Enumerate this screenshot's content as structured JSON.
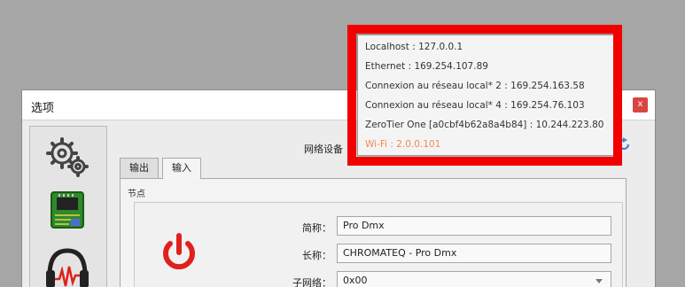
{
  "window": {
    "title": "选项",
    "close_glyph": "x"
  },
  "sidebar": {
    "items": [
      {
        "icon": "gears-icon"
      },
      {
        "icon": "circuit-board-icon"
      },
      {
        "icon": "headphones-audio-icon"
      }
    ]
  },
  "network": {
    "label": "网络设备",
    "refresh_icon": "refresh-icon",
    "options": [
      "Localhost : 127.0.0.1",
      "Ethernet : 169.254.107.89",
      "Connexion au réseau local* 2 : 169.254.163.58",
      "Connexion au réseau local* 4 : 169.254.76.103",
      "ZeroTier One [a0cbf4b62a8a4b84] : 10.244.223.80",
      "Wi-Fi : 2.0.0.101"
    ],
    "selected_index": 5
  },
  "tabs": [
    {
      "label": "输出",
      "active": false
    },
    {
      "label": "输入",
      "active": true
    }
  ],
  "node": {
    "group_label": "节点",
    "power_icon": "power-icon",
    "power_color": "#e0201c",
    "short_name_label": "简称：",
    "short_name_value": "Pro Dmx",
    "long_name_label": "长称：",
    "long_name_value": "CHROMATEQ - Pro Dmx",
    "subnet_label": "子网络：",
    "subnet_value": "0x00"
  },
  "colors": {
    "highlight": "#f20000",
    "selected_option": "#f08a50",
    "close_button": "#d9453f"
  }
}
